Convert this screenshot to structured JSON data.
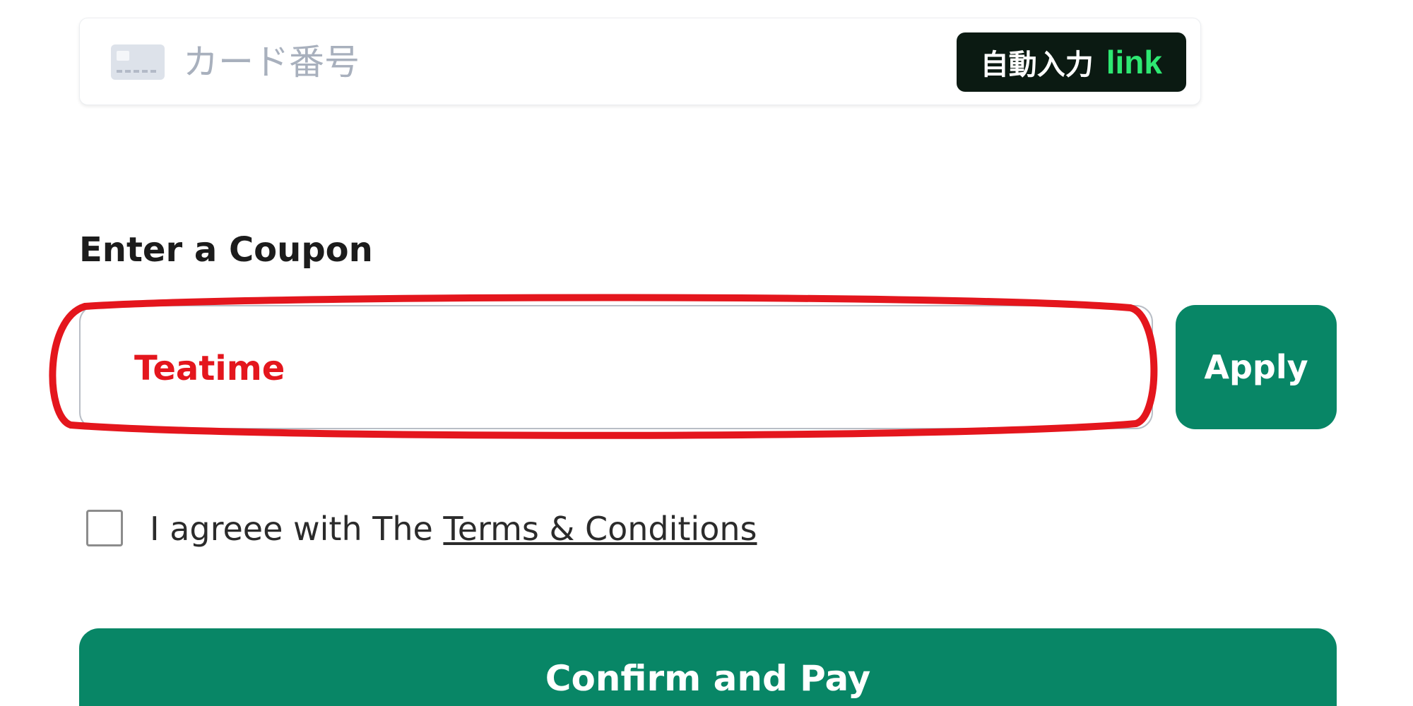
{
  "card_field": {
    "placeholder": "カード番号",
    "icon": "credit-card-icon",
    "autofill_label": "自動入力",
    "autofill_brand": "link"
  },
  "coupon": {
    "label": "Enter a Coupon",
    "value": "Teatime",
    "apply_label": "Apply"
  },
  "terms": {
    "checked": false,
    "prefix": "I agreee with The ",
    "link_text": "Terms & Conditions"
  },
  "confirm": {
    "label": "Confirm and Pay"
  },
  "colors": {
    "primary_green": "#088666",
    "highlight_red": "#e4161d",
    "autofill_bg": "#0b1a12",
    "link_green": "#2ee872"
  }
}
